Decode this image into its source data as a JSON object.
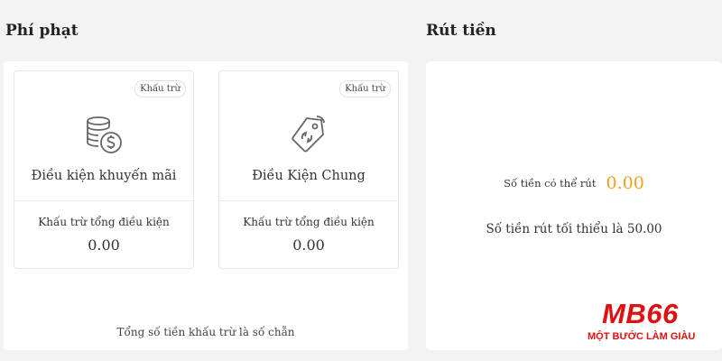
{
  "penalty": {
    "title": "Phí phạt",
    "cards": [
      {
        "badge": "Khấu trừ",
        "icon": "coins-dollar-icon",
        "title": "Điều kiện khuyến mãi",
        "label": "Khấu trừ tổng điều kiện",
        "value": "0.00"
      },
      {
        "badge": "Khấu trừ",
        "icon": "price-tag-icon",
        "title": "Điều Kiện Chung",
        "label": "Khấu trừ tổng điều kiện",
        "value": "0.00"
      }
    ],
    "footer": "Tổng số tiền khấu trừ là số chẵn"
  },
  "withdraw": {
    "title": "Rút tiền",
    "available_label": "Số tiền có thể rút",
    "available_value": "0.00",
    "minimum_text": "Số tiền rút tối thiểu là 50.00"
  },
  "logo": {
    "text": "MB66",
    "tagline": "MỘT BƯỚC LÀM GIÀU"
  },
  "colors": {
    "accent": "#f0a020",
    "brand": "#e01010",
    "background": "#f3f3f3"
  }
}
